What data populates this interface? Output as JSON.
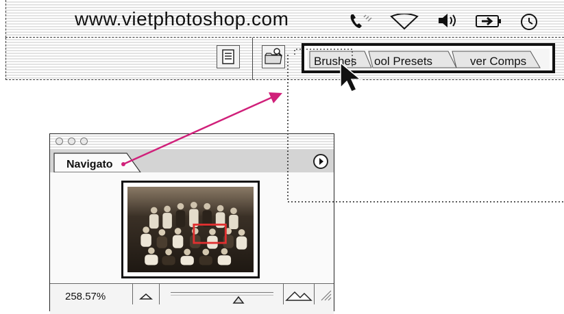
{
  "menubar": {
    "site_title": "www.vietphotoshop.com",
    "icons": [
      "phone-icon",
      "wifi-icon",
      "volume-icon",
      "battery-icon",
      "clock-icon"
    ]
  },
  "well": {
    "tabs": [
      "Brushes",
      "Tool Presets",
      "Layer Comps"
    ],
    "visible_labels": [
      "Brushes",
      "ool Presets",
      "ver Comps"
    ]
  },
  "navigator": {
    "tab_label": "Navigato",
    "zoom": "258.57%",
    "colors": {
      "highlight_box": "#e03030",
      "arrow": "#d0207a"
    }
  }
}
